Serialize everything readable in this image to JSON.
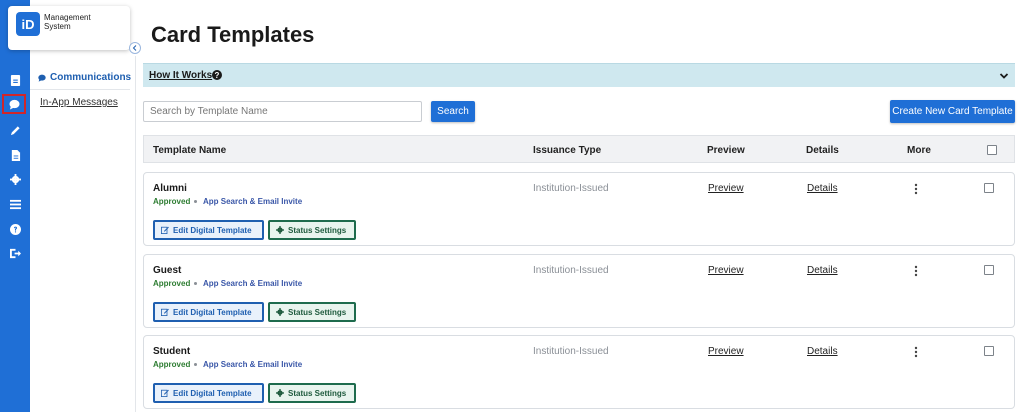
{
  "brand": {
    "logo_letters": "iD",
    "logo_text": "Management System",
    "accent": "#1f6fd6"
  },
  "rail": {
    "icons": [
      "id-card-icon",
      "chat-icon",
      "pen-icon",
      "document-icon",
      "gear-icon",
      "list-icon",
      "help-icon",
      "sign-out-icon"
    ]
  },
  "subnav": {
    "heading": "Communications",
    "items": [
      {
        "label": "In-App Messages"
      }
    ]
  },
  "page": {
    "title": "Card Templates"
  },
  "how_it_works": {
    "label": "How It Works"
  },
  "search": {
    "placeholder": "Search by Template Name",
    "button_label": "Search"
  },
  "toolbar": {
    "create_label": "Create New Card Template"
  },
  "table": {
    "columns": [
      "Template Name",
      "Issuance Type",
      "Preview",
      "Details",
      "More"
    ],
    "rows": [
      {
        "name": "Alumni",
        "status": "Approved",
        "type": "App Search & Email Invite",
        "issuance": "Institution-Issued",
        "preview": "Preview",
        "details": "Details",
        "edit_label": "Edit Digital Template",
        "status_label": "Status Settings"
      },
      {
        "name": "Guest",
        "status": "Approved",
        "type": "App Search & Email Invite",
        "issuance": "Institution-Issued",
        "preview": "Preview",
        "details": "Details",
        "edit_label": "Edit Digital Template",
        "status_label": "Status Settings"
      },
      {
        "name": "Student",
        "status": "Approved",
        "type": "App Search & Email Invite",
        "issuance": "Institution-Issued",
        "preview": "Preview",
        "details": "Details",
        "edit_label": "Edit Digital Template",
        "status_label": "Status Settings"
      }
    ]
  },
  "colors": {
    "approved": "#2e7d32",
    "invite_type": "#3a57a8",
    "how_bar": "#cfe8ef",
    "active_outline": "#d0262b"
  }
}
